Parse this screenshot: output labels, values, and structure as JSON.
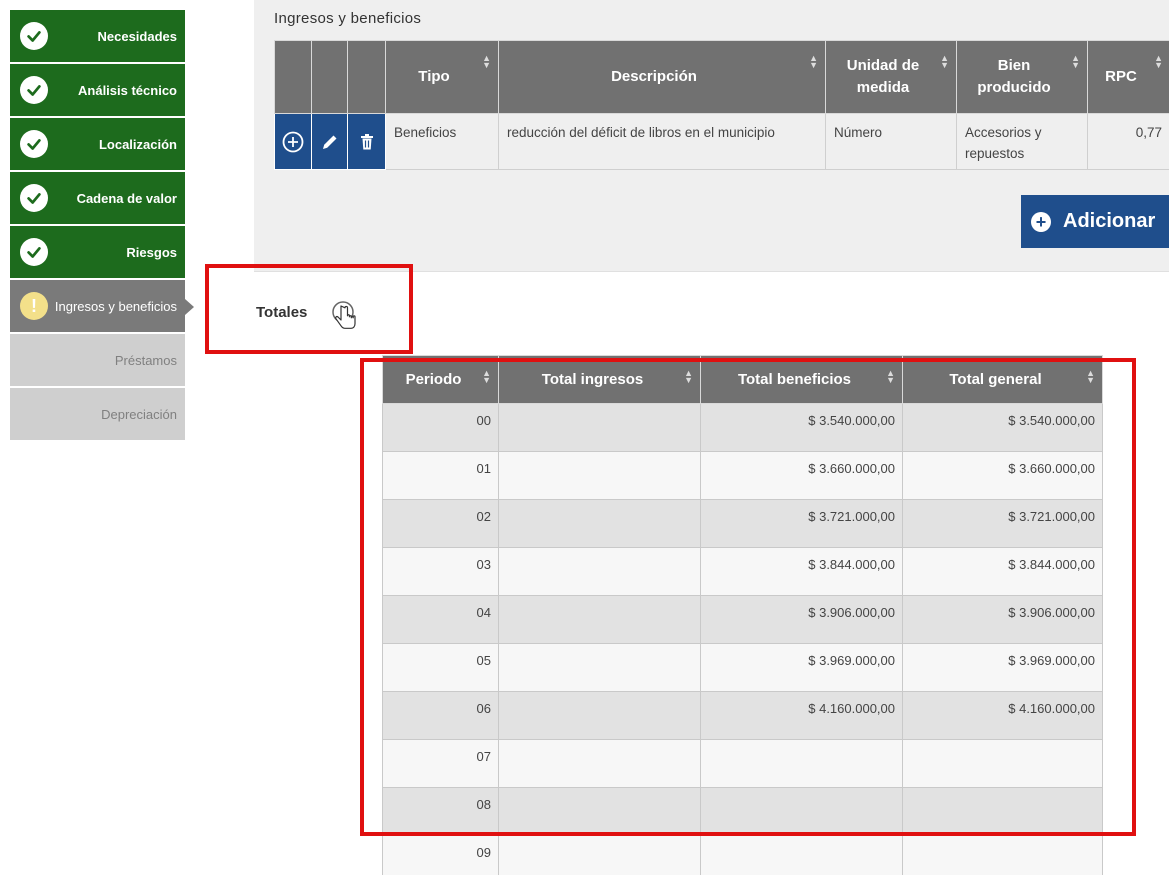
{
  "sidebar": {
    "steps": [
      {
        "label": "Necesidades",
        "state": "done"
      },
      {
        "label": "Análisis técnico",
        "state": "done"
      },
      {
        "label": "Localización",
        "state": "done"
      },
      {
        "label": "Cadena de valor",
        "state": "done"
      },
      {
        "label": "Riesgos",
        "state": "done"
      },
      {
        "label": "Ingresos y beneficios",
        "state": "current"
      },
      {
        "label": "Préstamos",
        "state": "pending"
      },
      {
        "label": "Depreciación",
        "state": "pending"
      }
    ]
  },
  "section": {
    "title": "Ingresos y beneficios",
    "table": {
      "headers": [
        "Tipo",
        "Descripción",
        "Unidad de medida",
        "Bien producido",
        "RPC"
      ],
      "rows": [
        {
          "tipo": "Beneficios",
          "descripcion": "reducción del déficit de libros en el municipio",
          "unidad": "Número",
          "bien": "Accesorios y repuestos",
          "rpc": "0,77"
        }
      ]
    },
    "add_button": "Adicionar"
  },
  "totales": {
    "label": "Totales",
    "headers": [
      "Periodo",
      "Total ingresos",
      "Total beneficios",
      "Total general"
    ],
    "rows": [
      {
        "periodo": "00",
        "ingresos": "",
        "beneficios": "$ 3.540.000,00",
        "general": "$ 3.540.000,00"
      },
      {
        "periodo": "01",
        "ingresos": "",
        "beneficios": "$ 3.660.000,00",
        "general": "$ 3.660.000,00"
      },
      {
        "periodo": "02",
        "ingresos": "",
        "beneficios": "$ 3.721.000,00",
        "general": "$ 3.721.000,00"
      },
      {
        "periodo": "03",
        "ingresos": "",
        "beneficios": "$ 3.844.000,00",
        "general": "$ 3.844.000,00"
      },
      {
        "periodo": "04",
        "ingresos": "",
        "beneficios": "$ 3.906.000,00",
        "general": "$ 3.906.000,00"
      },
      {
        "periodo": "05",
        "ingresos": "",
        "beneficios": "$ 3.969.000,00",
        "general": "$ 3.969.000,00"
      },
      {
        "periodo": "06",
        "ingresos": "",
        "beneficios": "$ 4.160.000,00",
        "general": "$ 4.160.000,00"
      },
      {
        "periodo": "07",
        "ingresos": "",
        "beneficios": "",
        "general": ""
      },
      {
        "periodo": "08",
        "ingresos": "",
        "beneficios": "",
        "general": ""
      },
      {
        "periodo": "09",
        "ingresos": "",
        "beneficios": "",
        "general": ""
      }
    ]
  },
  "colors": {
    "done": "#1d6b1d",
    "current": "#7a7a7a",
    "pending": "#cfcfcf",
    "header": "#717171",
    "action": "#1f4e8c",
    "highlight": "#e01010"
  }
}
